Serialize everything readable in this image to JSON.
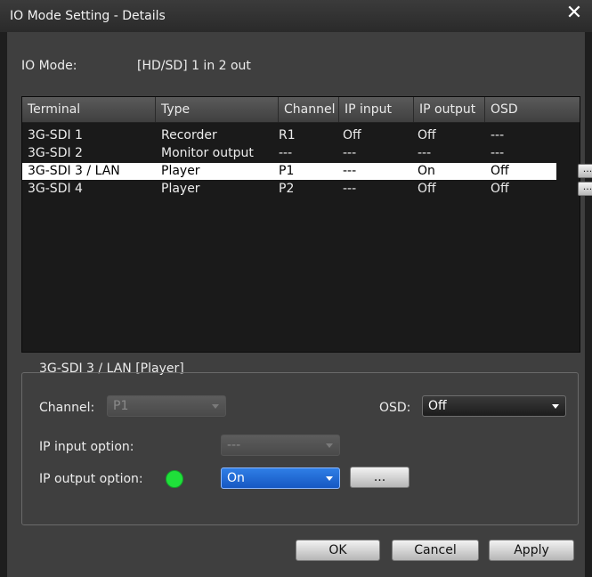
{
  "dialog": {
    "title": "IO Mode Setting - Details",
    "close_glyph": "✕"
  },
  "io_mode": {
    "label": "IO Mode:",
    "value": "[HD/SD] 1 in 2 out"
  },
  "table": {
    "columns": [
      "Terminal",
      "Type",
      "Channel",
      "IP input",
      "IP output",
      "OSD"
    ],
    "rows": [
      {
        "terminal": "3G-SDI 1",
        "type": "Recorder",
        "channel": "R1",
        "ip_input": "Off",
        "ip_output": "Off",
        "osd": "---",
        "button": ""
      },
      {
        "terminal": "3G-SDI 2",
        "type": "Monitor output",
        "channel": "---",
        "ip_input": "---",
        "ip_output": "---",
        "osd": "---",
        "button": ""
      },
      {
        "terminal": "3G-SDI 3 / LAN",
        "type": "Player",
        "channel": "P1",
        "ip_input": "---",
        "ip_output": "On",
        "osd": "Off",
        "button": "...",
        "selected": true
      },
      {
        "terminal": "3G-SDI 4",
        "type": "Player",
        "channel": "P2",
        "ip_input": "---",
        "ip_output": "Off",
        "osd": "Off",
        "button": "..."
      }
    ]
  },
  "details": {
    "group_title": "3G-SDI 3 / LAN [Player]",
    "channel_label": "Channel:",
    "channel_value": "P1",
    "osd_label": "OSD:",
    "osd_value": "Off",
    "ip_input_label": "IP input option:",
    "ip_input_value": "---",
    "ip_output_label": "IP output option:",
    "ip_output_value": "On",
    "ip_output_more": "...",
    "status_color": "#1fe03a"
  },
  "footer": {
    "ok": "OK",
    "cancel": "Cancel",
    "apply": "Apply"
  }
}
